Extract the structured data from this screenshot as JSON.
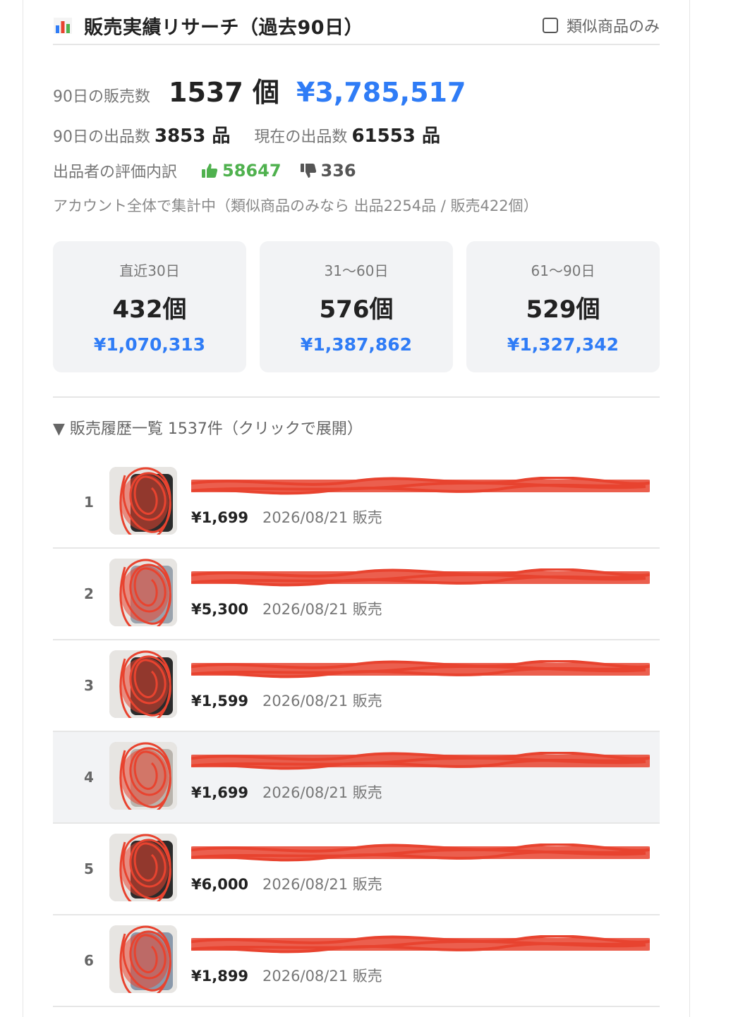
{
  "header": {
    "title": "販売実績リサーチ（過去90日）",
    "similar_only_label": "類似商品のみ",
    "similar_only_checked": false
  },
  "summary": {
    "sales_label": "90日の販売数",
    "sales_count": "1537 個",
    "sales_amount": "¥3,785,517",
    "listed_label": "90日の出品数",
    "listed_count": "3853 品",
    "current_label": "現在の出品数",
    "current_count": "61553 品",
    "rating_label": "出品者の評価内訳",
    "rating_good": "58647",
    "rating_bad": "336",
    "note": "アカウント全体で集計中（類似商品のみなら 出品2254品 / 販売422個）"
  },
  "periods": [
    {
      "label": "直近30日",
      "count": "432個",
      "amount": "¥1,070,313"
    },
    {
      "label": "31〜60日",
      "count": "576個",
      "amount": "¥1,387,862"
    },
    {
      "label": "61〜90日",
      "count": "529個",
      "amount": "¥1,327,342"
    }
  ],
  "history": {
    "toggle_label": "▼ 販売履歴一覧 1537件（クリックで展開）",
    "items": [
      {
        "rank": "1",
        "title": "",
        "price": "¥1,699",
        "date": "2026/08/21 販売"
      },
      {
        "rank": "2",
        "title": "",
        "price": "¥5,300",
        "date": "2026/08/21 販売"
      },
      {
        "rank": "3",
        "title": "",
        "price": "¥1,599",
        "date": "2026/08/21 販売"
      },
      {
        "rank": "4",
        "title": "",
        "price": "¥1,699",
        "date": "2026/08/21 販売"
      },
      {
        "rank": "5",
        "title": "",
        "price": "¥6,000",
        "date": "2026/08/21 販売"
      },
      {
        "rank": "6",
        "title": "",
        "price": "¥1,899",
        "date": "2026/08/21 販売"
      }
    ]
  },
  "colors": {
    "accent_blue": "#2f7cf6",
    "good_green": "#4fb14e",
    "redaction_red": "#e8432f"
  },
  "icons": {
    "title_icon": "bar-chart-icon",
    "good": "thumbs-up-icon",
    "bad": "thumbs-down-icon"
  }
}
